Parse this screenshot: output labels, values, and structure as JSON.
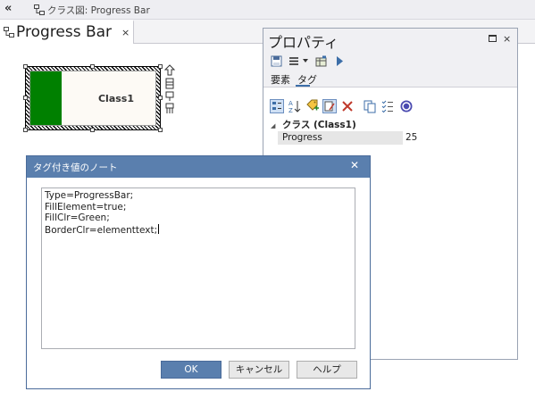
{
  "breadcrumb": {
    "collapse_glyph": "«",
    "icon": "class-diagram-icon",
    "text": "クラス図: Progress Bar"
  },
  "doc_tab": {
    "icon": "class-diagram-icon",
    "title": "Progress Bar",
    "close_glyph": "×"
  },
  "diagram": {
    "element": {
      "name": "Class1",
      "fill_color": "#008000",
      "progress": 0.25
    }
  },
  "properties": {
    "title": "プロパティ",
    "close_glyph": "×",
    "tabs": [
      {
        "label": "要素"
      },
      {
        "label": "タグ"
      }
    ],
    "group": {
      "toggle": "◢",
      "label": "クラス (Class1)"
    },
    "rows": [
      {
        "name": "Progress",
        "value": "25"
      }
    ]
  },
  "dialog": {
    "title": "タグ付き値のノート",
    "close_glyph": "✕",
    "lines": [
      "Type=ProgressBar;",
      "FillElement=true;",
      "FillClr=Green;",
      "BorderClr=elementtext;"
    ],
    "ok_label": "OK",
    "cancel_label": "キャンセル",
    "help_label": "ヘルプ"
  },
  "colors": {
    "accent": "#5a7fae",
    "fill": "#008000"
  }
}
